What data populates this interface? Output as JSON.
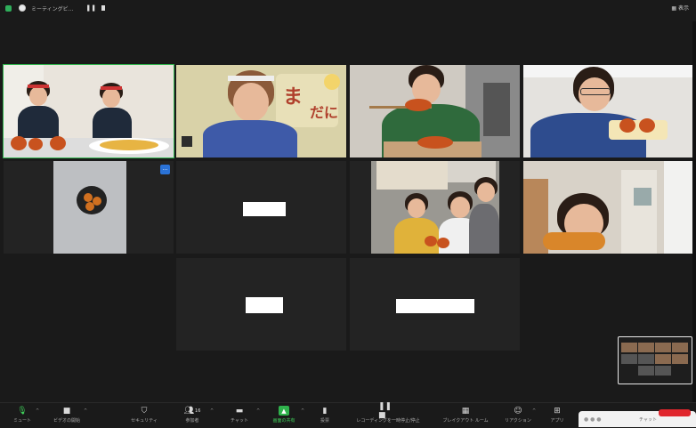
{
  "window": {
    "title": "ミーティングビ...",
    "view_label": "表示"
  },
  "toolbar": {
    "items": [
      {
        "id": "mic",
        "label": "ミュート"
      },
      {
        "id": "video",
        "label": "ビデオの開始"
      },
      {
        "id": "security",
        "label": "セキュリティ"
      },
      {
        "id": "participants",
        "label": "参加者",
        "count": "16"
      },
      {
        "id": "chat",
        "label": "チャット"
      },
      {
        "id": "share",
        "label": "画面の共有"
      },
      {
        "id": "poll",
        "label": "投票"
      },
      {
        "id": "record",
        "label": "レコーディングを一時停止/停止"
      },
      {
        "id": "breakout",
        "label": "ブレイクアウト ルーム"
      },
      {
        "id": "reaction",
        "label": "リアクション"
      },
      {
        "id": "apps",
        "label": "アプリ"
      }
    ]
  },
  "chat_popup": {
    "title": "チャット"
  },
  "colors": {
    "active_speaker": "#2fb24c",
    "share_green": "#2fb24c",
    "end_red": "#e0262d"
  }
}
